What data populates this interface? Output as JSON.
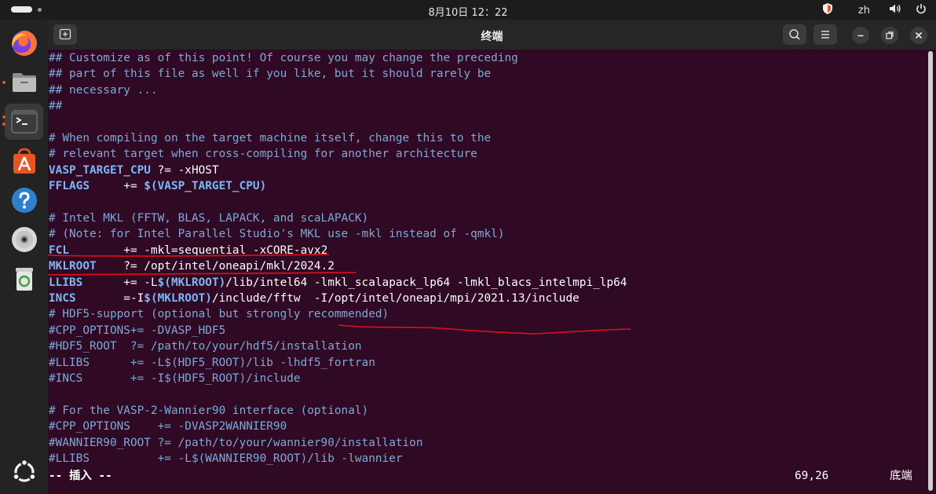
{
  "system_bar": {
    "clock": "8月10日  12：22",
    "input_method": "zh",
    "colors": {
      "bar_bg": "#1c1c1c"
    }
  },
  "dock": {
    "items": [
      {
        "name": "firefox-icon",
        "label": "Firefox"
      },
      {
        "name": "files-icon",
        "label": "Files"
      },
      {
        "name": "terminal-icon",
        "label": "Terminal"
      },
      {
        "name": "app-center-icon",
        "label": "App Center"
      },
      {
        "name": "help-icon",
        "label": "Help"
      },
      {
        "name": "disc-icon",
        "label": "Disc"
      },
      {
        "name": "trash-icon",
        "label": "Trash"
      },
      {
        "name": "show-apps-icon",
        "label": "Show Apps"
      }
    ]
  },
  "terminal": {
    "title": "终端",
    "colors": {
      "background": "#300a24",
      "comment": "#7ea8d6",
      "keyword": "#7ab7f5",
      "annotation": "#e0101a"
    },
    "lines": [
      [
        {
          "t": "## Customize as of this point! Of course you may change the preceding",
          "s": "c"
        }
      ],
      [
        {
          "t": "## part of this file as well if you like, but it should rarely be",
          "s": "c"
        }
      ],
      [
        {
          "t": "## necessary ...",
          "s": "c"
        }
      ],
      [
        {
          "t": "##",
          "s": "c"
        }
      ],
      [],
      [
        {
          "t": "# When compiling on the target machine itself, change this to the",
          "s": "c"
        }
      ],
      [
        {
          "t": "# relevant target when cross-compiling for another architecture",
          "s": "c"
        }
      ],
      [
        {
          "t": "VASP_TARGET_CPU",
          "s": "kw"
        },
        {
          "t": " ?= -xHOST",
          "s": "p"
        }
      ],
      [
        {
          "t": "FFLAGS",
          "s": "kw"
        },
        {
          "t": "     += ",
          "s": "p"
        },
        {
          "t": "$(VASP_TARGET_CPU)",
          "s": "kw"
        }
      ],
      [],
      [
        {
          "t": "# Intel MKL (FFTW, BLAS, LAPACK, and scaLAPACK)",
          "s": "c"
        }
      ],
      [
        {
          "t": "# (Note: for Intel Parallel Studio's MKL use -mkl instead of -qmkl)",
          "s": "c"
        }
      ],
      [
        {
          "t": "FCL",
          "s": "kw"
        },
        {
          "t": "        += -mkl=sequential -xCORE-avx2",
          "s": "p"
        }
      ],
      [
        {
          "t": "MKLROOT",
          "s": "kw"
        },
        {
          "t": "    ?= /opt/intel/oneapi/mkl/2024.2",
          "s": "p"
        }
      ],
      [
        {
          "t": "LLIBS",
          "s": "kw"
        },
        {
          "t": "      += -L",
          "s": "p"
        },
        {
          "t": "$(MKLROOT)",
          "s": "kw"
        },
        {
          "t": "/lib/intel64 -lmkl_scalapack_lp64 -lmkl_blacs_intelmpi_lp64",
          "s": "p"
        }
      ],
      [
        {
          "t": "INCS",
          "s": "kw"
        },
        {
          "t": "       =-I",
          "s": "p"
        },
        {
          "t": "$(MKLROOT)",
          "s": "kw"
        },
        {
          "t": "/include/fftw  -I/opt/intel/oneapi/mpi/2021.13/include",
          "s": "p"
        }
      ],
      [
        {
          "t": "# HDF5-support (optional but strongly recommended)",
          "s": "c"
        }
      ],
      [
        {
          "t": "#CPP_OPTIONS+= -DVASP_HDF5",
          "s": "c"
        }
      ],
      [
        {
          "t": "#HDF5_ROOT  ?= /path/to/your/hdf5/installation",
          "s": "c"
        }
      ],
      [
        {
          "t": "#LLIBS      += -L$(HDF5_ROOT)/lib -lhdf5_fortran",
          "s": "c"
        }
      ],
      [
        {
          "t": "#INCS       += -I$(HDF5_ROOT)/include",
          "s": "c"
        }
      ],
      [],
      [
        {
          "t": "# For the VASP-2-Wannier90 interface (optional)",
          "s": "c"
        }
      ],
      [
        {
          "t": "#CPP_OPTIONS    += -DVASP2WANNIER90",
          "s": "c"
        }
      ],
      [
        {
          "t": "#WANNIER90_ROOT ?= /path/to/your/wannier90/installation",
          "s": "c"
        }
      ],
      [
        {
          "t": "#LLIBS          += -L$(WANNIER90_ROOT)/lib -lwannier",
          "s": "c"
        }
      ]
    ],
    "status": {
      "mode": "-- 插入 --",
      "position": "69,26",
      "scroll": "底端"
    }
  }
}
